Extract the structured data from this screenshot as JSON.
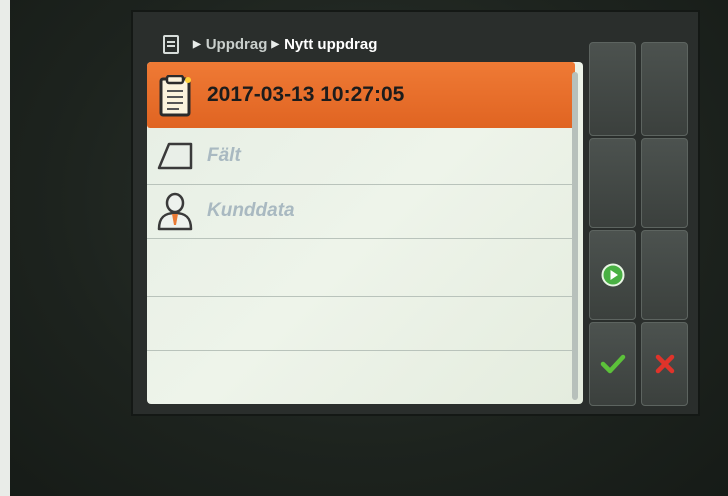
{
  "breadcrumb": {
    "items": [
      "Uppdrag",
      "Nytt uppdrag"
    ]
  },
  "list": {
    "items": [
      {
        "label": "2017-03-13 10:27:05",
        "icon": "clipboard-icon",
        "selected": true
      },
      {
        "label": "Fält",
        "icon": "field-icon",
        "selected": false
      },
      {
        "label": "Kunddata",
        "icon": "customer-icon",
        "selected": false
      },
      {
        "label": "",
        "selected": false
      },
      {
        "label": "",
        "selected": false
      }
    ]
  },
  "softkeys": [
    {
      "name": "softkey-1",
      "icon": ""
    },
    {
      "name": "softkey-2",
      "icon": ""
    },
    {
      "name": "softkey-3",
      "icon": ""
    },
    {
      "name": "softkey-4",
      "icon": ""
    },
    {
      "name": "softkey-5",
      "icon": "play-icon"
    },
    {
      "name": "softkey-6",
      "icon": ""
    },
    {
      "name": "confirm",
      "icon": "checkmark-icon"
    },
    {
      "name": "cancel",
      "icon": "close-icon"
    }
  ],
  "colors": {
    "selected_row": "#e86e2b",
    "confirm": "#5cc13a",
    "cancel": "#e0332a",
    "play": "#49b043"
  }
}
